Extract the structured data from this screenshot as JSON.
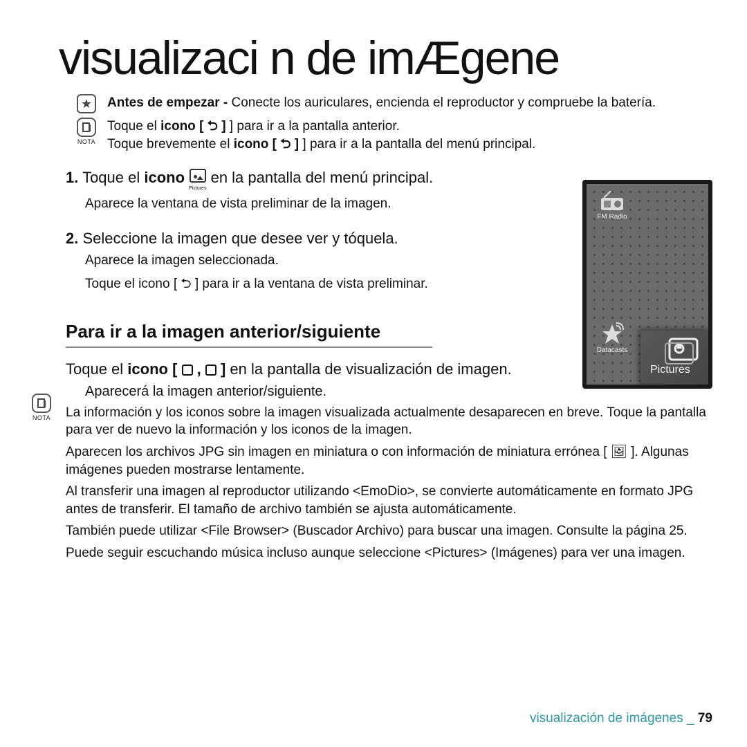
{
  "title": "visualizaci n de imÆgene",
  "star_line_pre": "Antes de empezar - ",
  "star_line": "Conecte los auriculares, encienda el reproductor y compruebe la batería.",
  "note1a_pre": "Toque el ",
  "note1a_bold": "icono [",
  "note1a_post": "] para ir a la pantalla anterior.",
  "note1b_pre": "Toque brevemente el ",
  "note1b_bold": "icono [",
  "note1b_post": "] para ir a la pantalla del menú principal.",
  "nota_label": "NOTA",
  "step1_num": "1.",
  "step1_pre": " Toque el ",
  "step1_bold": "icono ",
  "step1_post": " en la pantalla del menú principal.",
  "step1_sub": "Aparece la ventana de vista preliminar de la imagen.",
  "step2_num": "2.",
  "step2_text": " Seleccione la imagen que desee ver y tóquela.",
  "step2_sub1": "Aparece la imagen seleccionada.",
  "step2_sub2": "Toque el icono [ ⮌ ] para ir a la ventana de vista preliminar.",
  "pictures_small_label": "Pictures",
  "device": {
    "fm": "FM Radio",
    "datacasts": "Datacasts",
    "pictures": "Pictures"
  },
  "subheading": "Para ir a la imagen anterior/siguiente",
  "sub_body_pre": "Toque el ",
  "sub_body_bold": "icono [ ",
  "sub_body_mid": " , ",
  "sub_body_post": " ] ",
  "sub_body_end": "en la pantalla de visualización de imagen.",
  "sub_indent": "Aparecerá la imagen anterior/siguiente.",
  "bullets": [
    "La información y los iconos sobre la imagen visualizada actualmente desaparecen en breve. Toque la pantalla para ver de nuevo la información y los iconos de la imagen.",
    "Aparecen los archivos JPG sin imagen en miniatura o con información de miniatura errónea [  🖼  ]. Algunas imágenes pueden mostrarse lentamente.",
    "Al transferir una imagen al reproductor utilizando <EmoDio>, se convierte automáticamente en formato JPG antes de transferir. El tamaño de archivo también se ajusta automáticamente.",
    "También puede utilizar <File Browser> (Buscador Archivo) para buscar una imagen. Consulte la página 25.",
    "Puede seguir escuchando música incluso aunque seleccione <Pictures> (Imágenes) para ver una imagen."
  ],
  "footer_section": "visualización de imágenes _ ",
  "footer_page": "79"
}
